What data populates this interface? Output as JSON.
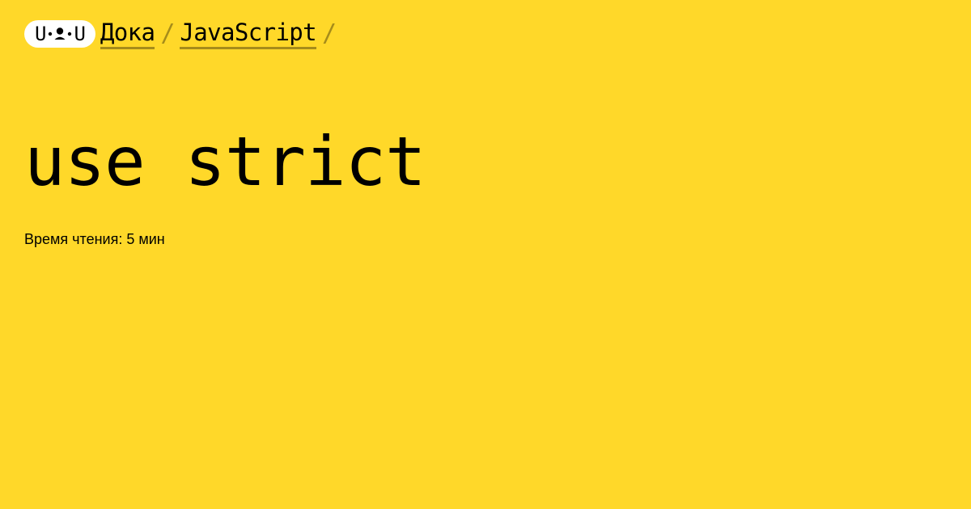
{
  "logo": {
    "left_letter": "U",
    "right_letter": "U",
    "icon": "face-icon"
  },
  "breadcrumb": {
    "items": [
      {
        "label": "Дока"
      },
      {
        "label": "JavaScript"
      }
    ],
    "separator": "/"
  },
  "article": {
    "title": "use strict",
    "reading_time": "Время чтения: 5 мин"
  },
  "colors": {
    "background": "#FFD829",
    "text": "#000000",
    "logo_background": "#FFFFFF",
    "underline": "rgba(0,0,0,0.35)"
  }
}
